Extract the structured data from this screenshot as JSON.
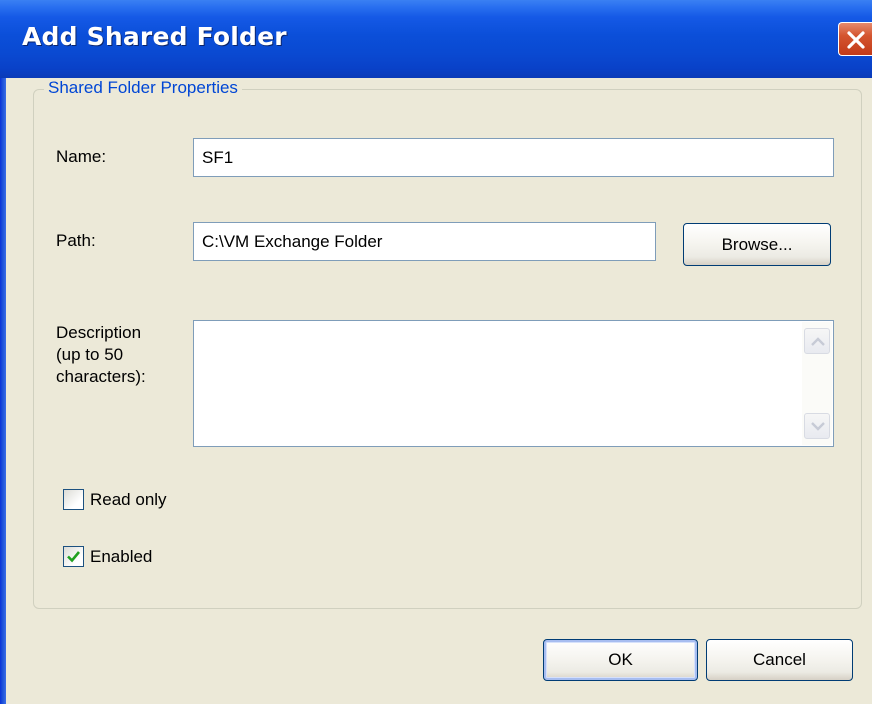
{
  "window": {
    "title": "Add Shared Folder",
    "close_icon": "close-icon"
  },
  "group": {
    "legend": "Shared Folder Properties"
  },
  "form": {
    "name_label": "Name:",
    "name_value": "SF1",
    "path_label": "Path:",
    "path_value": "C:\\VM Exchange Folder",
    "browse_label": "Browse...",
    "description_label_line1": "Description",
    "description_label_line2": "(up to 50",
    "description_label_line3": "characters):",
    "description_value": "",
    "read_only_label": "Read only",
    "read_only_checked": false,
    "enabled_label": "Enabled",
    "enabled_checked": true
  },
  "buttons": {
    "ok_label": "OK",
    "cancel_label": "Cancel"
  },
  "colors": {
    "titlebar": "#0b4fd9",
    "dialog_bg": "#ece9d8",
    "legend_text": "#0046d5",
    "close_button": "#d4552f",
    "checkmark": "#21a121"
  }
}
